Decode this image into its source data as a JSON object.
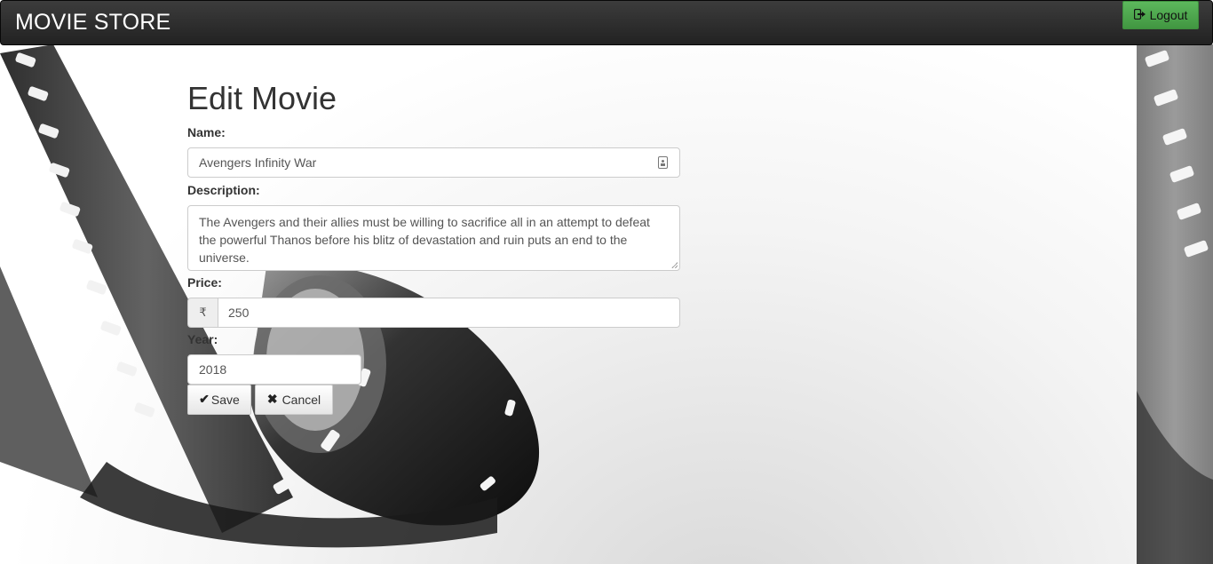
{
  "navbar": {
    "brand": "MOVIE STORE",
    "logout_label": "Logout",
    "logout_icon": "logout-icon",
    "logout_color": "#5cb85c"
  },
  "page": {
    "title": "Edit Movie"
  },
  "form": {
    "name_label": "Name:",
    "name_value": "Avengers Infinity War",
    "description_label": "Description:",
    "description_value": "The Avengers and their allies must be willing to sacrifice all in an attempt to defeat the powerful Thanos before his blitz of devastation and ruin puts an end to the universe.",
    "price_label": "Price:",
    "price_currency": "₹",
    "price_value": "250",
    "year_label": "Year:",
    "year_value": "2018",
    "save_label": "Save",
    "save_icon": "checkmark-icon",
    "cancel_label": "Cancel",
    "cancel_icon": "close-icon"
  }
}
